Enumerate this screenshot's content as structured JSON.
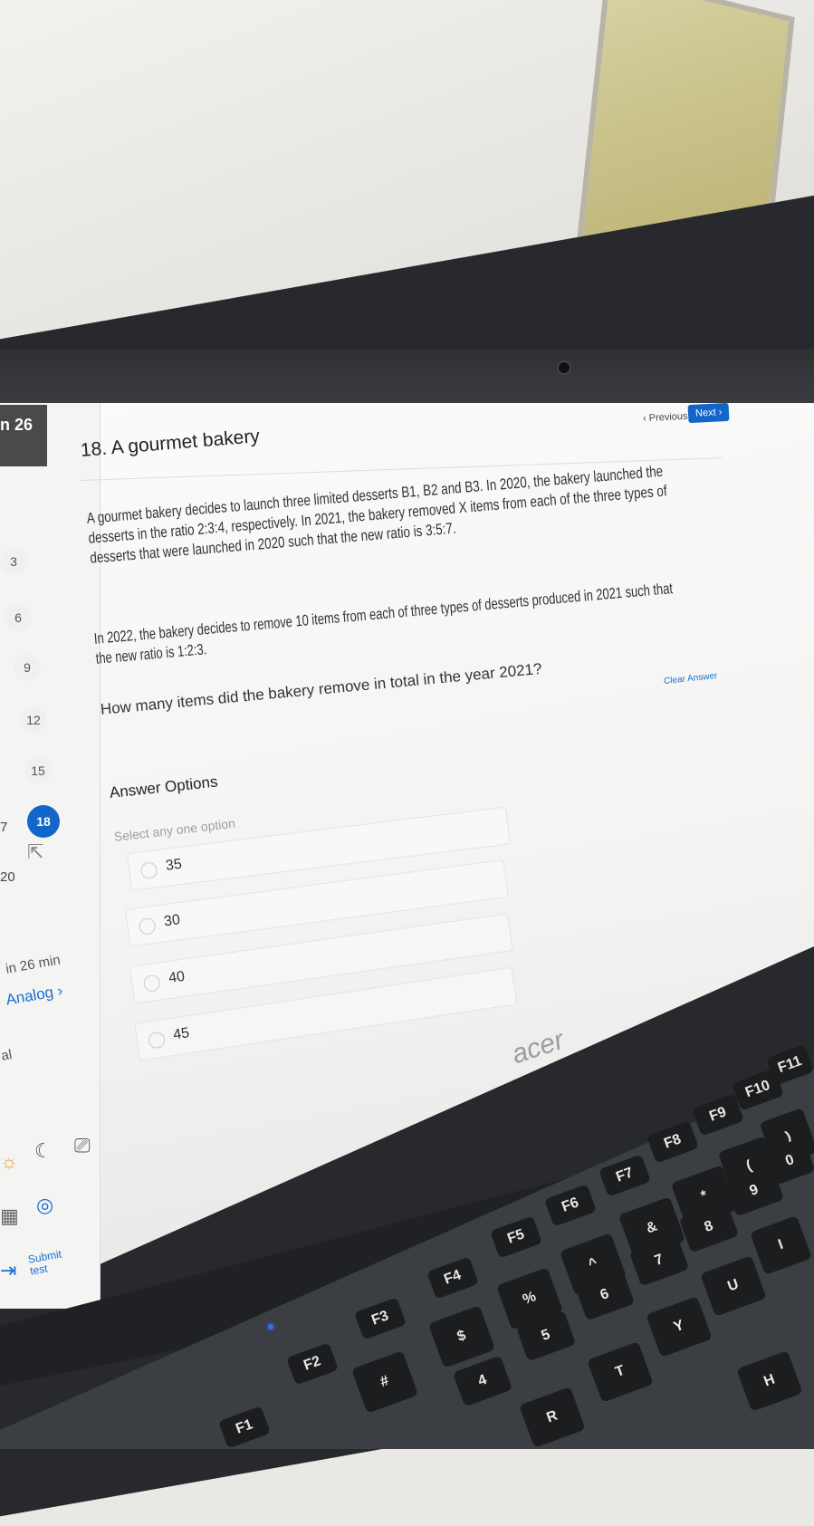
{
  "header": {
    "timer_fragment": "n 26",
    "question_title": "18. A gourmet bakery",
    "prev_label": "‹ Previous",
    "next_label": "Next ›"
  },
  "question": {
    "para1": [
      "A gourmet bakery decides to launch three limited desserts B1, B2 and B3. In 2020, the bakery launched the",
      "desserts in the ratio 2:3:4, respectively. In 2021, the bakery removed X items from each of the three types of",
      "desserts that were launched in 2020 such that the new ratio is 3:5:7."
    ],
    "para2": [
      "In 2022, the bakery decides to remove 10 items from each of three types of desserts produced in 2021 such that",
      "the new ratio is 1:2:3."
    ],
    "prompt": "How many items did the bakery remove in total in the year 2021?",
    "clear_label": "Clear Answer"
  },
  "answers": {
    "title": "Answer Options",
    "hint": "Select any one option",
    "options": [
      "35",
      "30",
      "40",
      "45"
    ]
  },
  "sidebar": {
    "question_numbers": [
      "3",
      "6",
      "9",
      "12",
      "15",
      "18"
    ],
    "edge_numbers": [
      "7",
      "20"
    ],
    "time_left": "in 26 min",
    "section_link": "Analog ›",
    "edge_label": "al",
    "submit_label": "Submit test"
  },
  "laptop": {
    "brand": "acer",
    "keys": [
      "F1",
      "F2",
      "F3",
      "F4",
      "F5",
      "F6",
      "F7",
      "F8",
      "F9",
      "F10",
      "F11",
      "#",
      "$",
      "%",
      "^",
      "&",
      "*",
      "(",
      ")",
      "4",
      "5",
      "6",
      "7",
      "8",
      "9",
      "0",
      "R",
      "T",
      "Y",
      "U",
      "I",
      "H"
    ]
  },
  "colors": {
    "accent": "#1366c9",
    "timer_bg": "#4a4a4a"
  }
}
